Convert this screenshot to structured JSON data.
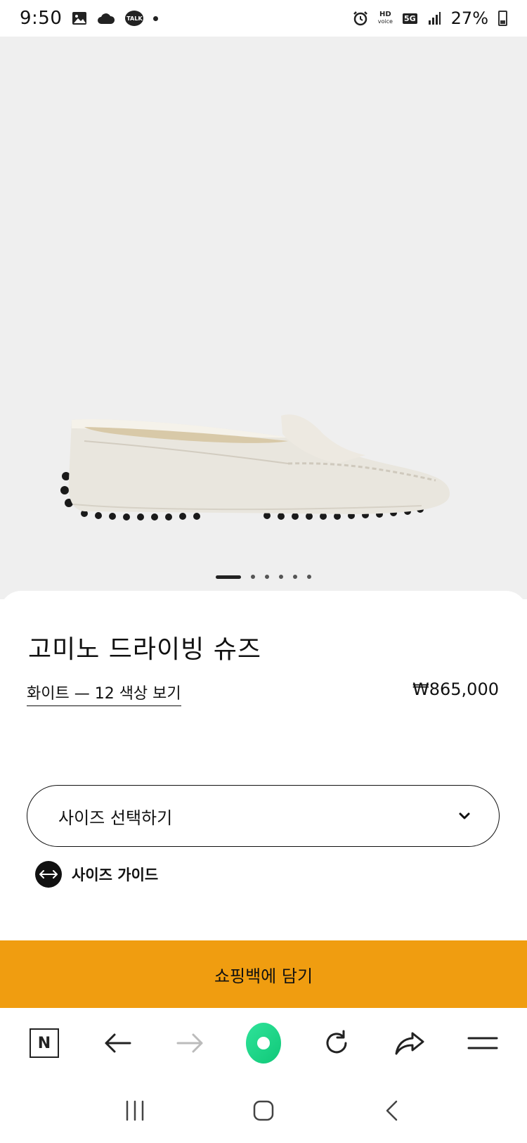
{
  "status_bar": {
    "time": "9:50",
    "icons": [
      "gallery-icon",
      "cloud-icon",
      "talk-icon",
      "dot-icon"
    ],
    "talk_label": "TALK",
    "hd_label": "HD",
    "voice_label": "voice",
    "network": "5G",
    "battery": "27%"
  },
  "hero": {
    "carousel_count": 6,
    "carousel_active": 0
  },
  "product": {
    "title": "고미노 드라이빙 슈즈",
    "color_link": "화이트 — 12 색상 보기",
    "price": "₩865,000"
  },
  "size_select": {
    "label": "사이즈 선택하기"
  },
  "size_guide": {
    "label": "사이즈 가이드"
  },
  "cart": {
    "button_label": "쇼핑백에 담기",
    "color": "#f09d10"
  },
  "browser_toolbar": {
    "items": [
      "naver-n-icon",
      "back-arrow-icon",
      "forward-arrow-icon",
      "green-home-icon",
      "refresh-icon",
      "share-icon",
      "menu-icon"
    ],
    "green": "#19d584"
  },
  "system_nav": {
    "items": [
      "recent-apps-icon",
      "home-icon",
      "back-icon"
    ]
  }
}
